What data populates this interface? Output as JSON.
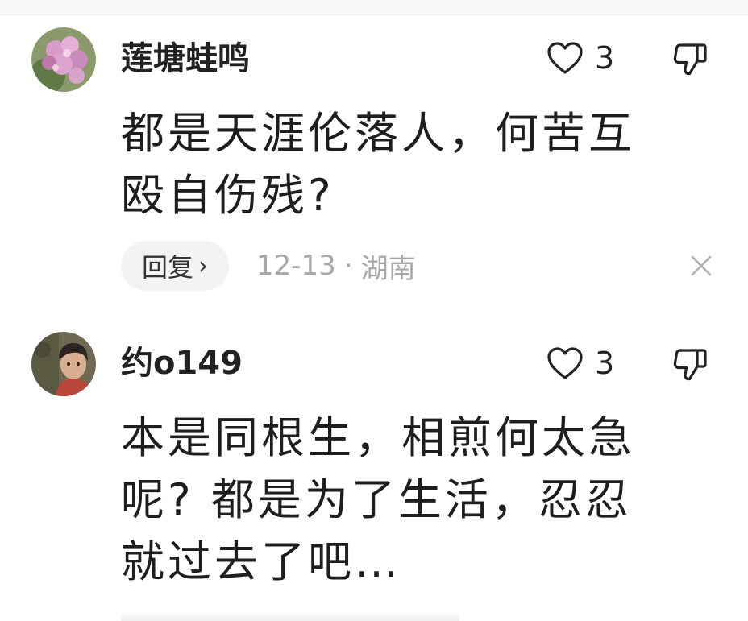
{
  "comments": [
    {
      "username": "莲塘蛙鸣",
      "likes": "3",
      "text_lines": [
        "都是天涯伦落人，何苦互",
        "殴自伤残?"
      ],
      "reply_label": "回复",
      "date": "12-13",
      "separator": "·",
      "location": "湖南",
      "avatar": "flower-avatar"
    },
    {
      "username": "约o149",
      "likes": "3",
      "text_lines": [
        "本是同根生，相煎何太急",
        "呢? 都是为了生活，忍忍",
        "就过去了吧…"
      ],
      "avatar": "person-avatar"
    }
  ],
  "icons": {
    "like": "heart-outline-icon",
    "dislike": "thumbs-down-icon",
    "close": "close-x-icon",
    "reply_chevron": "chevron-right-icon"
  },
  "colors": {
    "text": "#222222",
    "meta": "#a8a8a8",
    "pill_bg": "#f3f3f3"
  }
}
